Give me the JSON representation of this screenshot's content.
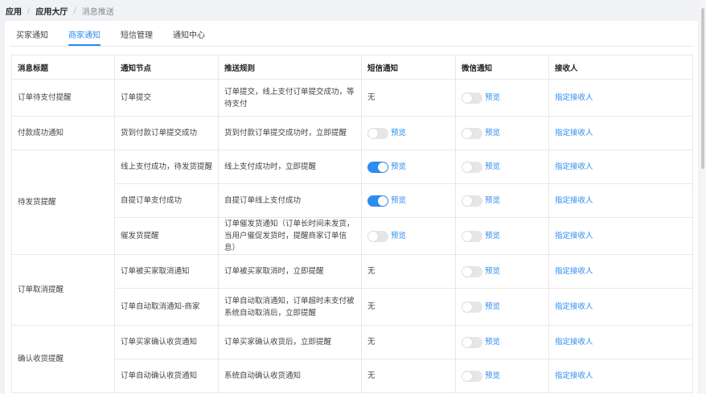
{
  "breadcrumb": {
    "items": [
      "应用",
      "应用大厅",
      "消息推送"
    ],
    "separator": "/"
  },
  "tabs": [
    "买家通知",
    "商家通知",
    "短信管理",
    "通知中心"
  ],
  "active_tab": 1,
  "table": {
    "headers": [
      "消息标题",
      "通知节点",
      "推送规则",
      "短信通知",
      "微信通知",
      "接收人"
    ],
    "preview_label": "预览",
    "none_label": "无",
    "receiver_label": "指定接收人",
    "groups": [
      {
        "title": "订单待支付提醒",
        "rows": [
          {
            "node": "订单提交",
            "rule": "订单提交，线上支付订单提交成功，等待支付",
            "sms": "none",
            "wechat": "off",
            "height": 46
          }
        ]
      },
      {
        "title": "付款成功通知",
        "rows": [
          {
            "node": "货到付款订单提交成功",
            "rule": "货到付款订单提交成功时，立即提醒",
            "sms": "off",
            "wechat": "off",
            "height": 42
          }
        ]
      },
      {
        "title": "待发货提醒",
        "rows": [
          {
            "node": "线上支付成功，待发货提醒",
            "rule": "线上支付成功时，立即提醒",
            "sms": "on",
            "wechat": "off",
            "height": 42
          },
          {
            "node": "自提订单支付成功",
            "rule": "自提订单线上支付成功",
            "sms": "on",
            "wechat": "off",
            "height": 42
          },
          {
            "node": "催发货提醒",
            "rule": "订单催发货通知（订单长时间未发货，当用户催促发货时，提醒商家订单信息）",
            "sms": "off",
            "wechat": "off",
            "height": 46
          }
        ]
      },
      {
        "title": "订单取消提醒",
        "rows": [
          {
            "node": "订单被买家取消通知",
            "rule": "订单被买家取消时，立即提醒",
            "sms": "none",
            "wechat": "off",
            "height": 42
          },
          {
            "node": "订单自动取消通知-商家",
            "rule": "订单自动取消通知，订单超时未支付被系统自动取消后，立即提醒",
            "sms": "none",
            "wechat": "off",
            "height": 46
          }
        ]
      },
      {
        "title": "确认收货提醒",
        "rows": [
          {
            "node": "订单买家确认收货通知",
            "rule": "订单买家确认收货后，立即提醒",
            "sms": "none",
            "wechat": "off",
            "height": 42
          },
          {
            "node": "订单自动确认收货通知",
            "rule": "系统自动确认收货通知",
            "sms": "none",
            "wechat": "off",
            "height": 42
          }
        ]
      }
    ]
  },
  "colors": {
    "accent": "#2d8cf0",
    "toggle_off": "#e6e6e6",
    "border": "#e8e8e8"
  }
}
